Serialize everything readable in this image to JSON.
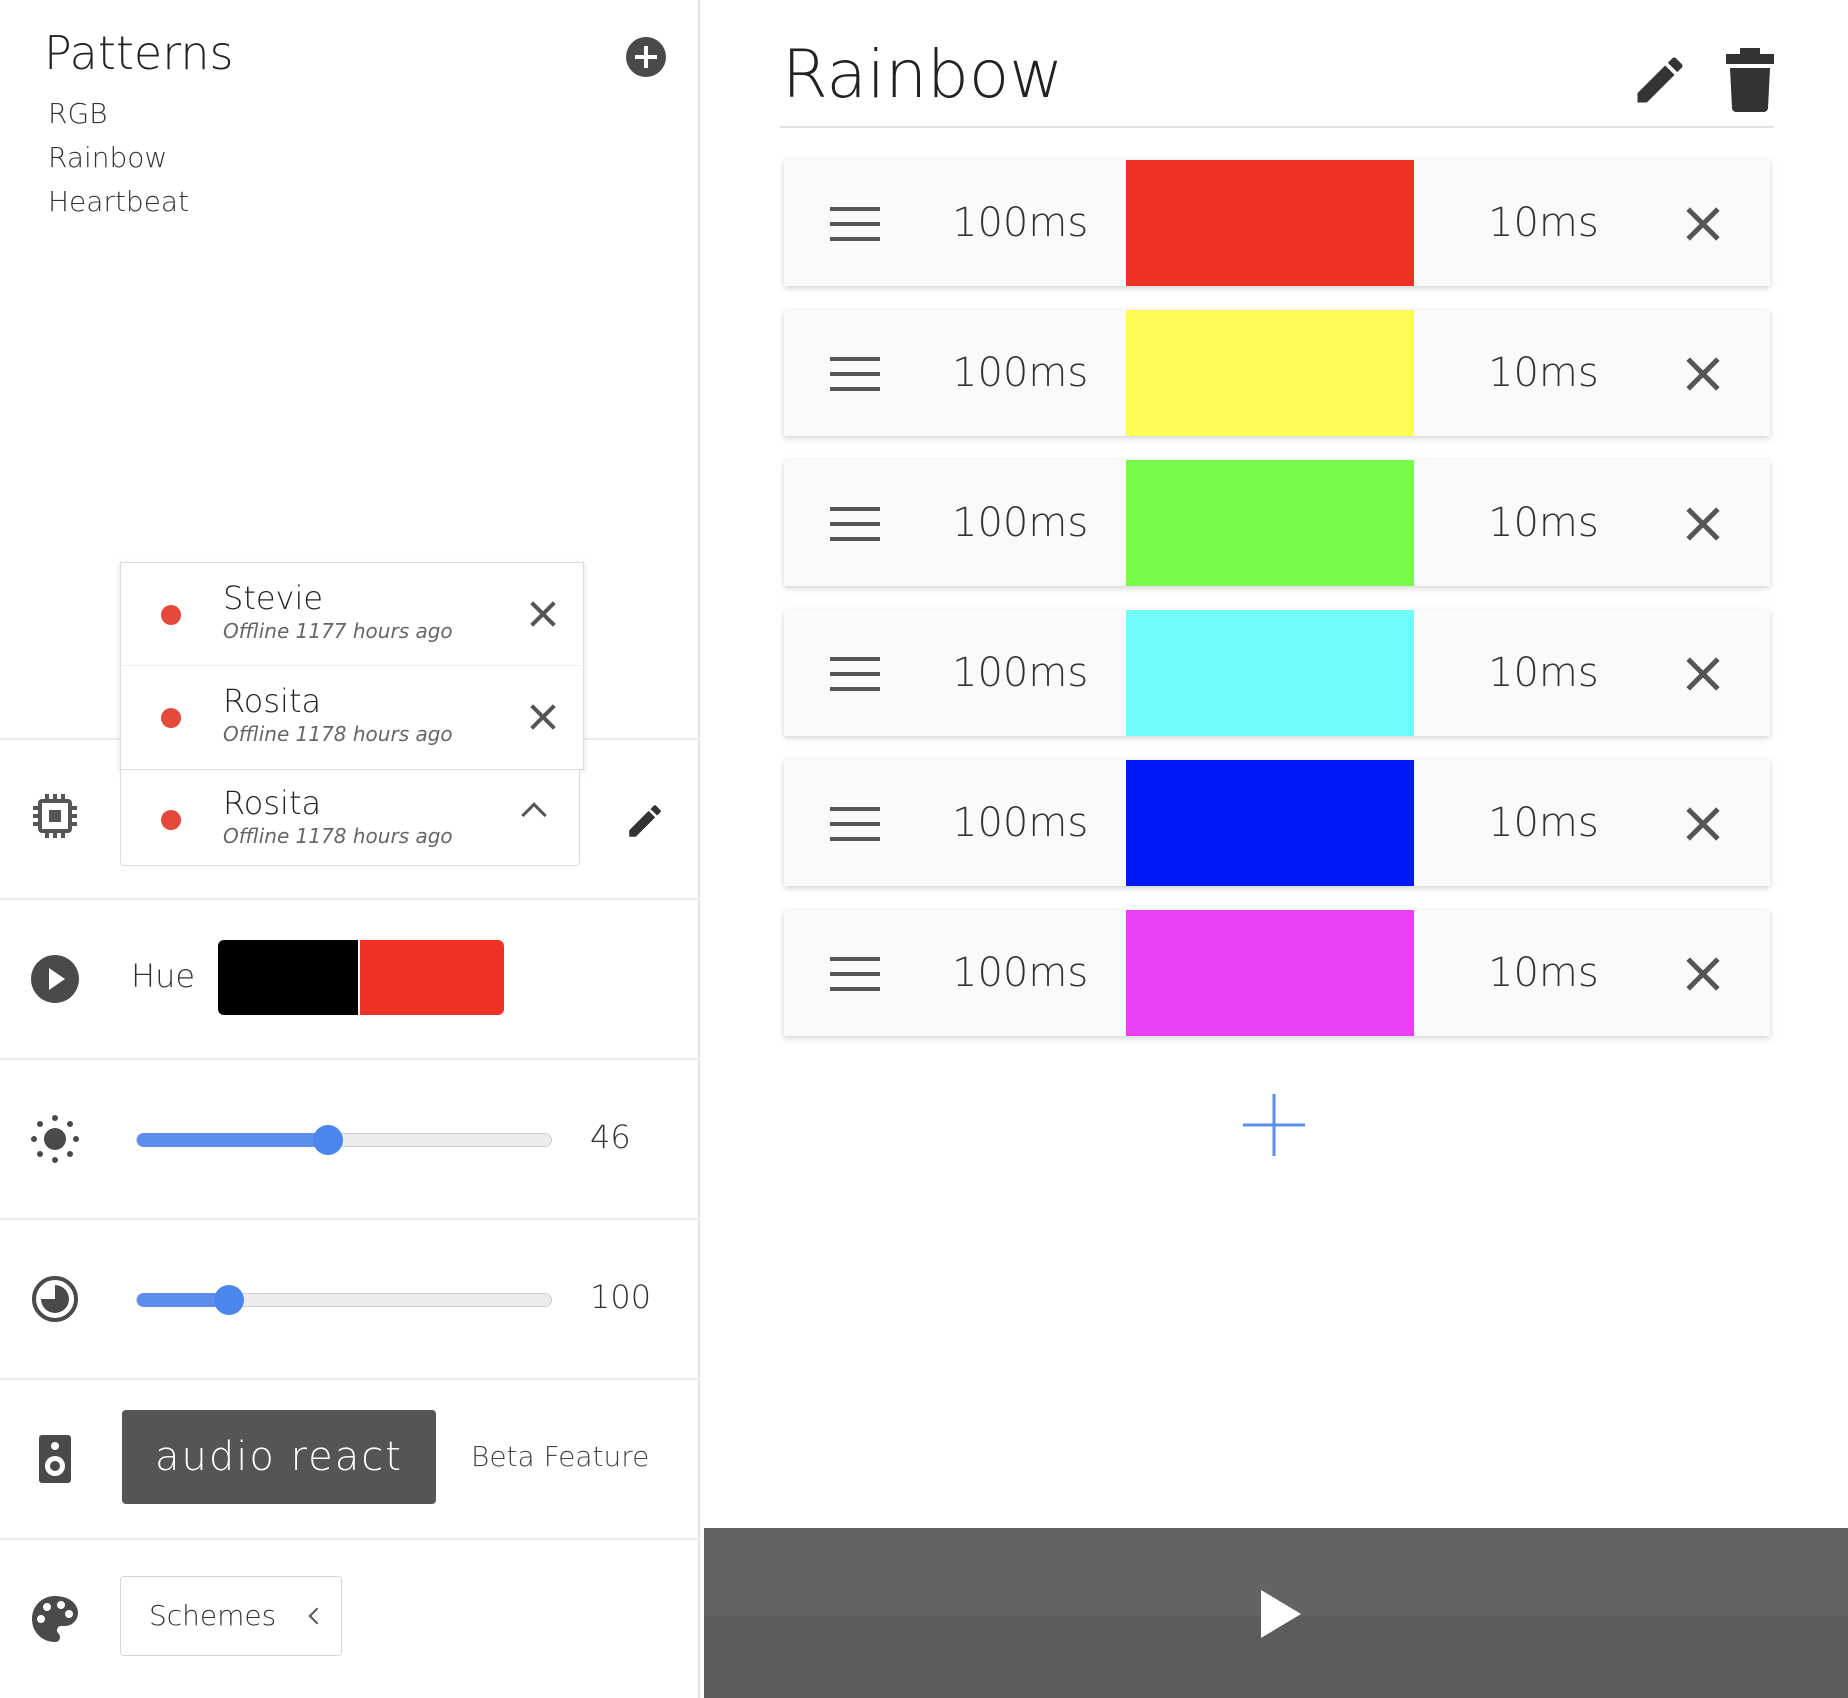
{
  "patterns": {
    "title": "Patterns",
    "items": [
      "RGB",
      "Rainbow",
      "Heartbeat"
    ]
  },
  "devices": {
    "list": [
      {
        "name": "Stevie",
        "status": "Offline 1177 hours ago"
      },
      {
        "name": "Rosita",
        "status": "Offline 1178 hours ago"
      }
    ],
    "selected": {
      "name": "Rosita",
      "status": "Offline 1178 hours ago"
    },
    "status_color": "#e5493c"
  },
  "controls": {
    "hue_label": "Hue",
    "hue_colors": [
      "#000000",
      "#ef3224"
    ],
    "brightness": {
      "value": "46",
      "level": 0.46
    },
    "speed": {
      "value": "100",
      "level": 0.22
    },
    "audio_react_label": "audio react",
    "beta_label": "Beta Feature",
    "schemes_label": "Schemes"
  },
  "editor": {
    "title": "Rainbow",
    "steps": [
      {
        "duration": "100ms",
        "color": "#ef3224",
        "transition": "10ms"
      },
      {
        "duration": "100ms",
        "color": "#fefc56",
        "transition": "10ms"
      },
      {
        "duration": "100ms",
        "color": "#76fa4c",
        "transition": "10ms"
      },
      {
        "duration": "100ms",
        "color": "#6ffcfb",
        "transition": "10ms"
      },
      {
        "duration": "100ms",
        "color": "#0019f5",
        "transition": "10ms"
      },
      {
        "duration": "100ms",
        "color": "#ea40f5",
        "transition": "10ms"
      }
    ]
  },
  "colors": {
    "accent": "#5a8fee",
    "button_dark": "#555555",
    "play_bar": "#636363"
  },
  "icons": [
    "add-circle-icon",
    "chip-icon",
    "pencil-icon",
    "play-circle-icon",
    "brightness-icon",
    "timer-icon",
    "speaker-icon",
    "palette-icon",
    "drag-handle-icon",
    "close-icon",
    "trash-icon",
    "plus-icon",
    "play-icon",
    "chevron-up-icon",
    "chevron-left-icon"
  ]
}
